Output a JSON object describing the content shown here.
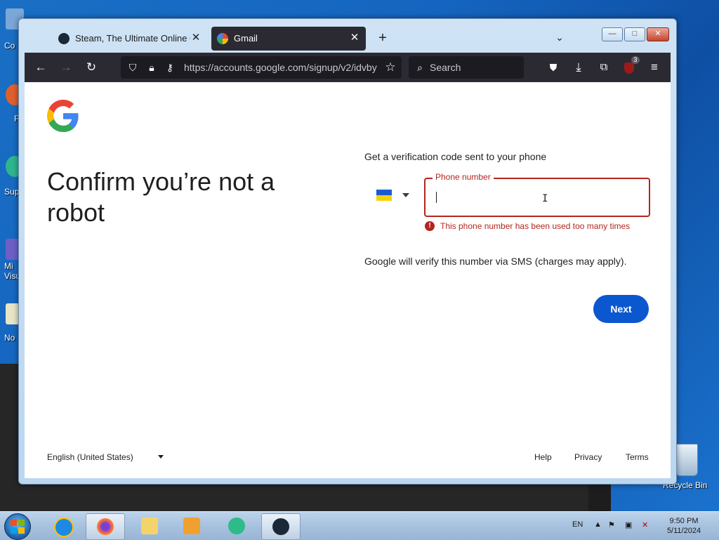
{
  "desktop": {
    "icons": [
      "Co",
      "F",
      "Sup",
      "Mi\nVisu",
      "No"
    ],
    "recycle_bin": "Recycle Bin"
  },
  "browser": {
    "tabs": [
      {
        "title": "Steam, The Ultimate Online Game Platform",
        "active": false,
        "icon": "steam-icon"
      },
      {
        "title": "Gmail",
        "active": true,
        "icon": "google-icon"
      }
    ],
    "new_tab": "+",
    "url": "https://accounts.google.com/signup/v2/idvby",
    "search_placeholder": "Search",
    "extension_badge": "3",
    "window_buttons": {
      "minimize": "—",
      "maximize": "□",
      "close": "✕"
    }
  },
  "page": {
    "heading": "Confirm you’re not a robot",
    "subtext": "Get a verification code sent to your phone",
    "country_flag": "Ukraine",
    "phone_label": "Phone number",
    "phone_value": "",
    "error_text": "This phone number has been used too many times",
    "sms_note": "Google will verify this number via SMS (charges may apply).",
    "next_label": "Next",
    "language": "English (United States)",
    "footer": {
      "help": "Help",
      "privacy": "Privacy",
      "terms": "Terms"
    }
  },
  "taskbar": {
    "apps": [
      "internet-explorer",
      "firefox",
      "file-explorer",
      "media-player",
      "chat-app",
      "steam"
    ],
    "language": "EN",
    "time": "9:50 PM",
    "date": "5/11/2024"
  },
  "colors": {
    "accent": "#0b57d0",
    "error": "#b3261e",
    "toolbar": "#2b2a33"
  }
}
